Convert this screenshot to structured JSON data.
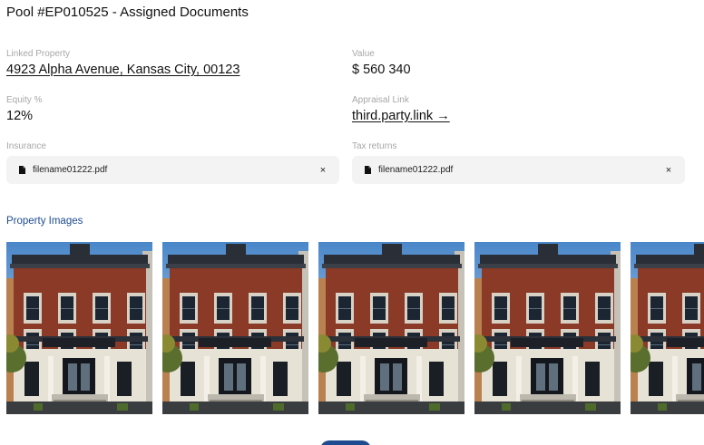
{
  "header": {
    "title": "Pool #EP010525 - Assigned Documents"
  },
  "details": {
    "linked_property": {
      "label": "Linked Property",
      "value": "4923 Alpha Avenue, Kansas City, 00123"
    },
    "value": {
      "label": "Value",
      "value": "$ 560 340"
    },
    "equity": {
      "label": "Equity %",
      "value": "12%"
    },
    "appraisal": {
      "label": "Appraisal Link",
      "value": "third.party.link →"
    },
    "insurance": {
      "label": "Insurance",
      "file": "filename01222.pdf",
      "remove": "×"
    },
    "tax_returns": {
      "label": "Tax returns",
      "file": "filename01222.pdf",
      "remove": "×"
    }
  },
  "images_section": {
    "title": "Property Images",
    "images": [
      "building-photo",
      "building-photo",
      "building-photo",
      "building-photo",
      "building-photo"
    ]
  },
  "colors": {
    "accent": "#1e4b8f",
    "chip_bg": "#f3f3f3",
    "label": "#a7a7a7",
    "brick": "#8a3a26"
  }
}
